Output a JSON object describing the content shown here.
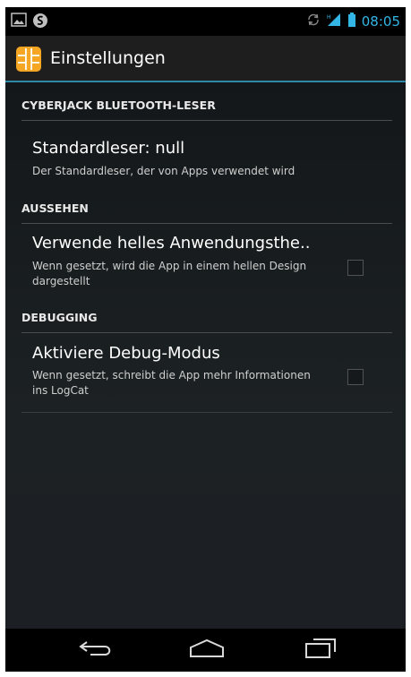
{
  "status_bar": {
    "time": "08:05",
    "left_icons": [
      "image-notification-icon",
      "app-notification-icon"
    ],
    "right_icons": [
      "sync-icon",
      "signal-icon",
      "battery-icon"
    ]
  },
  "action_bar": {
    "title": "Einstellungen",
    "icon": "sim-card-chip-icon"
  },
  "sections": [
    {
      "header": "CYBERJACK BLUETOOTH-LESER",
      "items": [
        {
          "title": "Standardleser: null",
          "summary": "Der Standardleser, der von Apps verwendet wird",
          "has_checkbox": false
        }
      ]
    },
    {
      "header": "AUSSEHEN",
      "items": [
        {
          "title": "Verwende helles Anwendungsthe..",
          "summary": "Wenn gesetzt, wird die App in einem hellen Design dargestellt",
          "has_checkbox": true,
          "checked": false
        }
      ]
    },
    {
      "header": "DEBUGGING",
      "items": [
        {
          "title": "Aktiviere Debug-Modus",
          "summary": "Wenn gesetzt, schreibt die App mehr Informationen ins LogCat",
          "has_checkbox": true,
          "checked": false
        }
      ]
    }
  ],
  "nav_bar": {
    "buttons": [
      "back-icon",
      "home-icon",
      "recent-apps-icon"
    ]
  },
  "colors": {
    "accent": "#33b5e5",
    "action_bar_underline": "#2e88a8",
    "app_icon": "#f5a623"
  }
}
